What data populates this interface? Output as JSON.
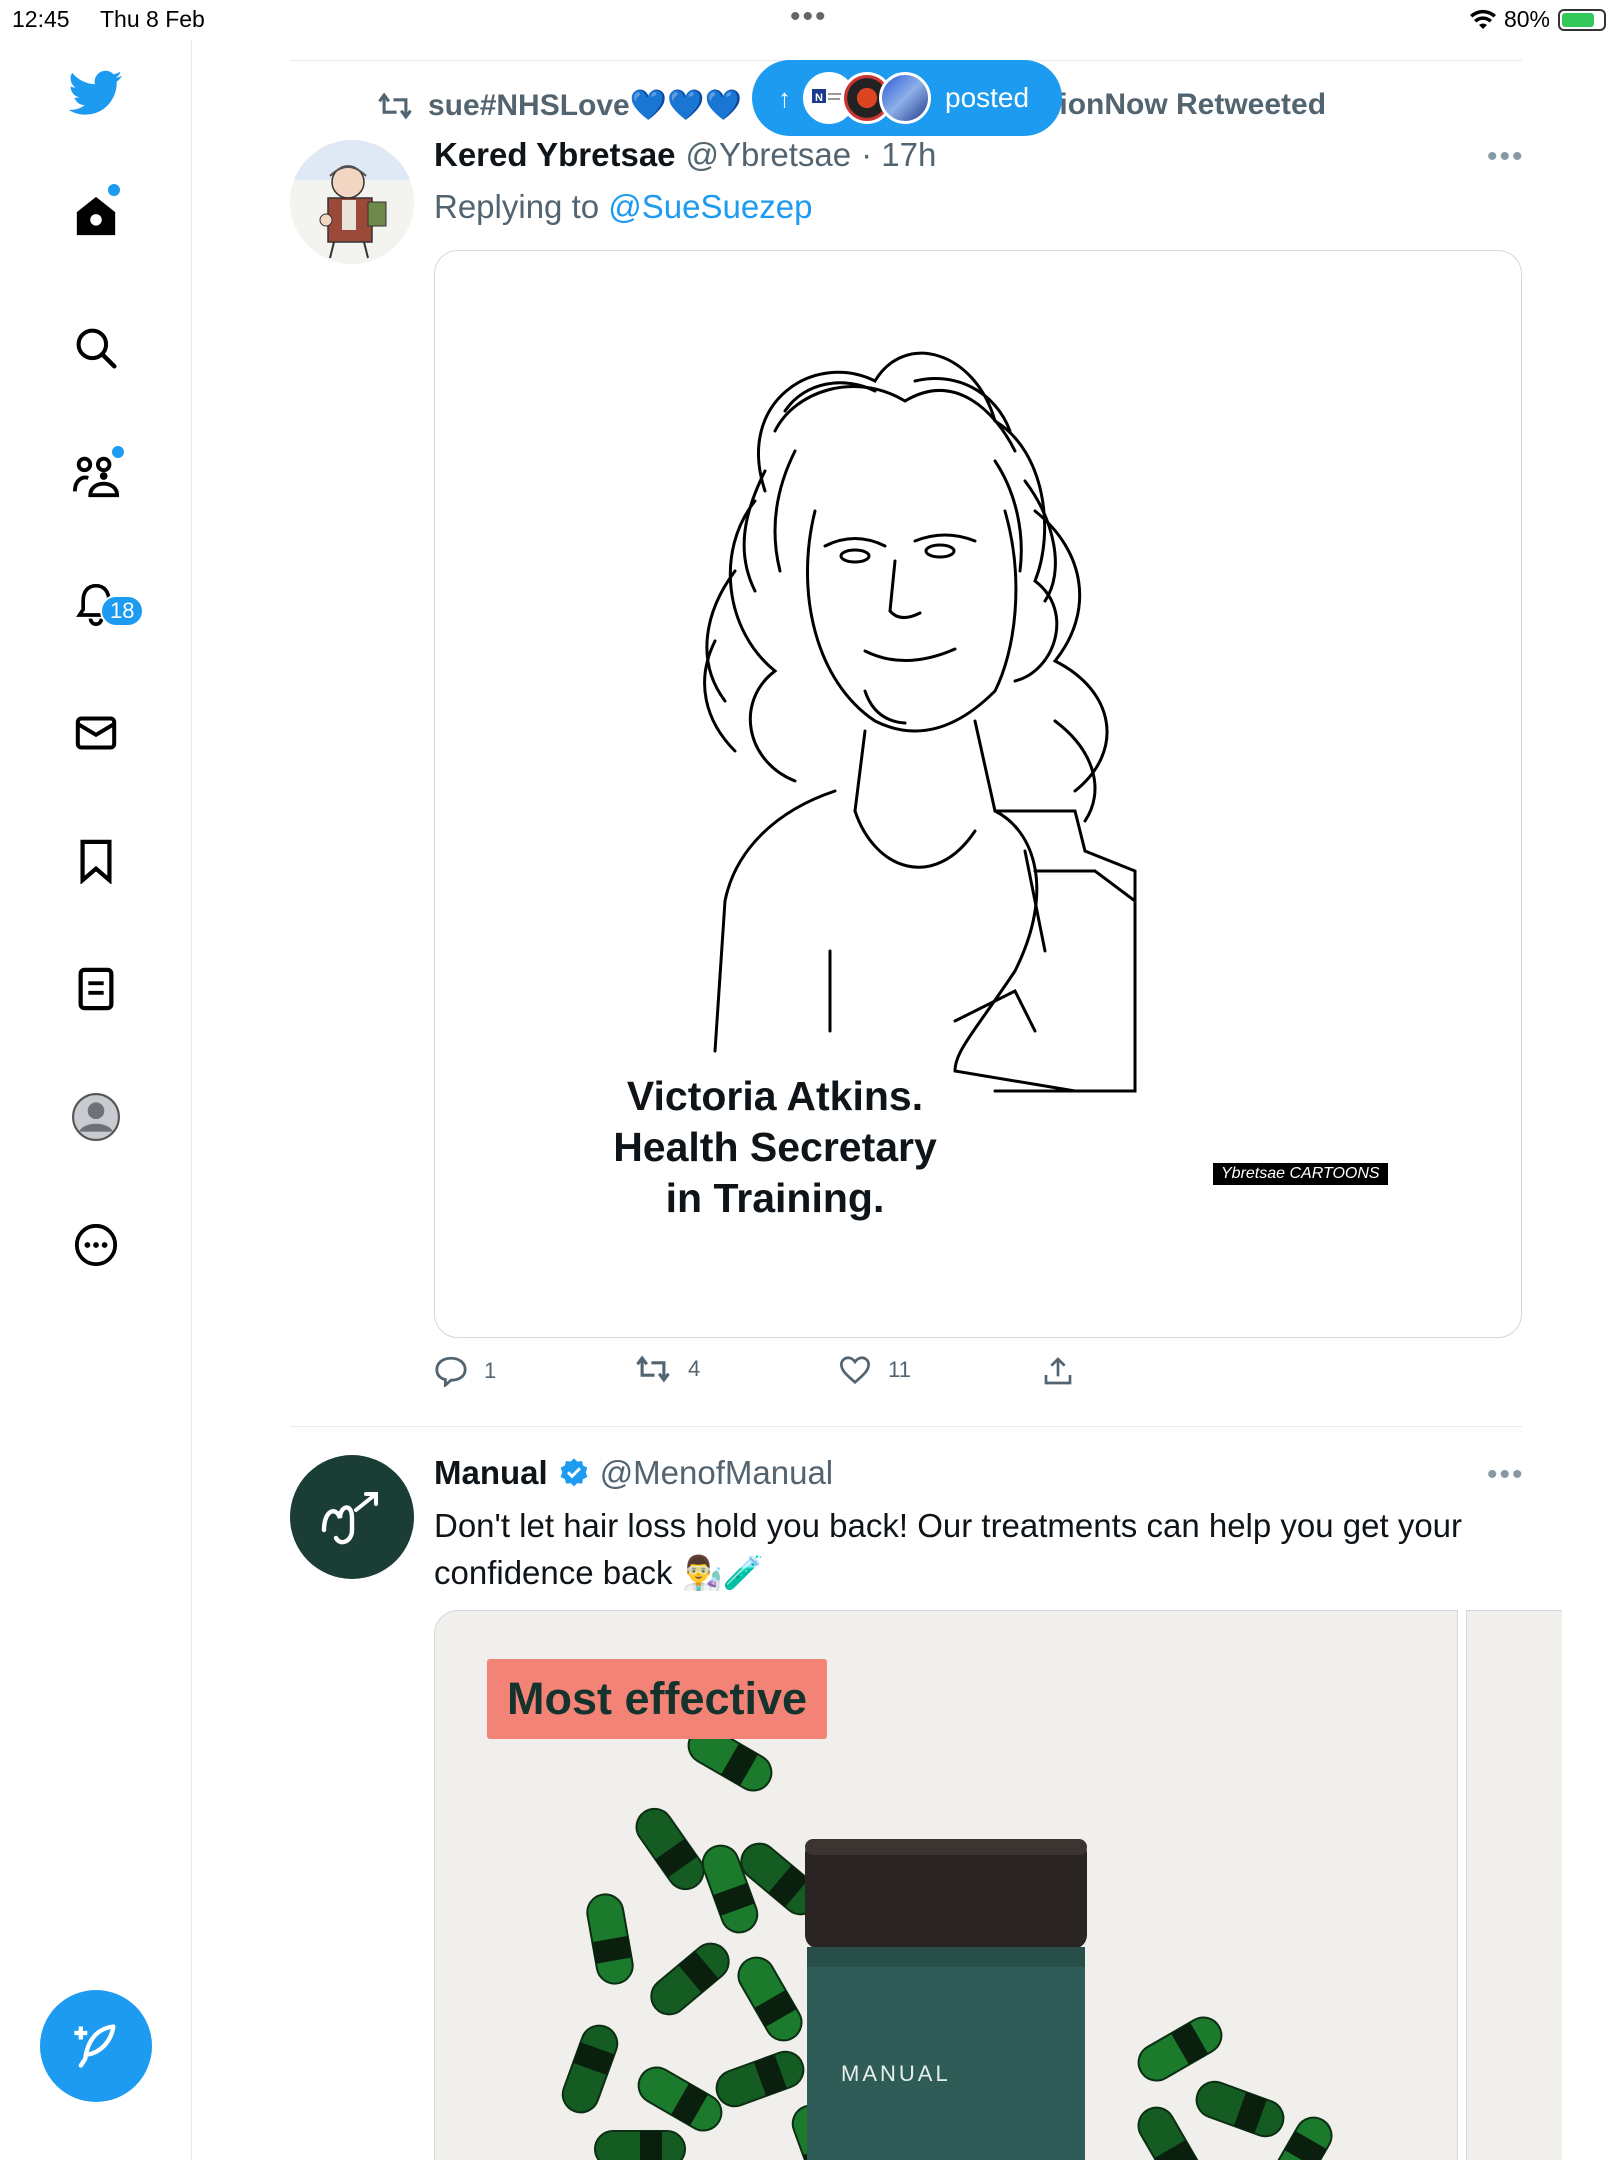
{
  "status_bar": {
    "time": "12:45",
    "date": "Thu 8 Feb",
    "battery": "80%",
    "battery_level": 0.8
  },
  "sidebar": {
    "items": [
      {
        "name": "twitter-logo",
        "icon": "twitter-bird-icon"
      },
      {
        "name": "home",
        "icon": "home-icon"
      },
      {
        "name": "explore",
        "icon": "search-icon"
      },
      {
        "name": "communities",
        "icon": "communities-icon"
      },
      {
        "name": "notifications",
        "icon": "bell-icon",
        "badge": "18"
      },
      {
        "name": "messages",
        "icon": "envelope-icon"
      },
      {
        "name": "bookmarks",
        "icon": "bookmark-icon"
      },
      {
        "name": "lists",
        "icon": "list-icon"
      },
      {
        "name": "profile",
        "icon": "profile-avatar-icon"
      },
      {
        "name": "more",
        "icon": "more-circle-icon"
      }
    ],
    "notification_badge": "18",
    "compose_icon": "compose-feather-icon"
  },
  "new_posts_pill": {
    "label": "posted"
  },
  "tweet1": {
    "retweeted_by_left": "sue#NHSLove💙💙💙",
    "retweeted_by_right": "ectionNow Retweeted",
    "name": "Kered Ybretsae",
    "handle": "@Ybretsae",
    "time": "· 17h",
    "replying_prefix": "Replying to",
    "replying_to": "@SueSuezep",
    "image_caption_line1": "Victoria Atkins.",
    "image_caption_line2": "Health Secretary",
    "image_caption_line3": "in Training.",
    "image_signature": "Ybretsae CARTOONS",
    "replies": "1",
    "retweets": "4",
    "likes": "11"
  },
  "tweet2": {
    "name": "Manual",
    "handle": "@MenofManual",
    "text": "Don't let hair loss hold you back! Our treatments can help you get your confidence back 👨‍🔬🧪",
    "badge_text": "Most effective",
    "bottle_label": "MANUAL",
    "brand_color": "#1a3d36",
    "badge_color": "#f38377"
  },
  "colors": {
    "accent": "#1d9bf0",
    "text": "#0f1419",
    "muted": "#536471"
  }
}
